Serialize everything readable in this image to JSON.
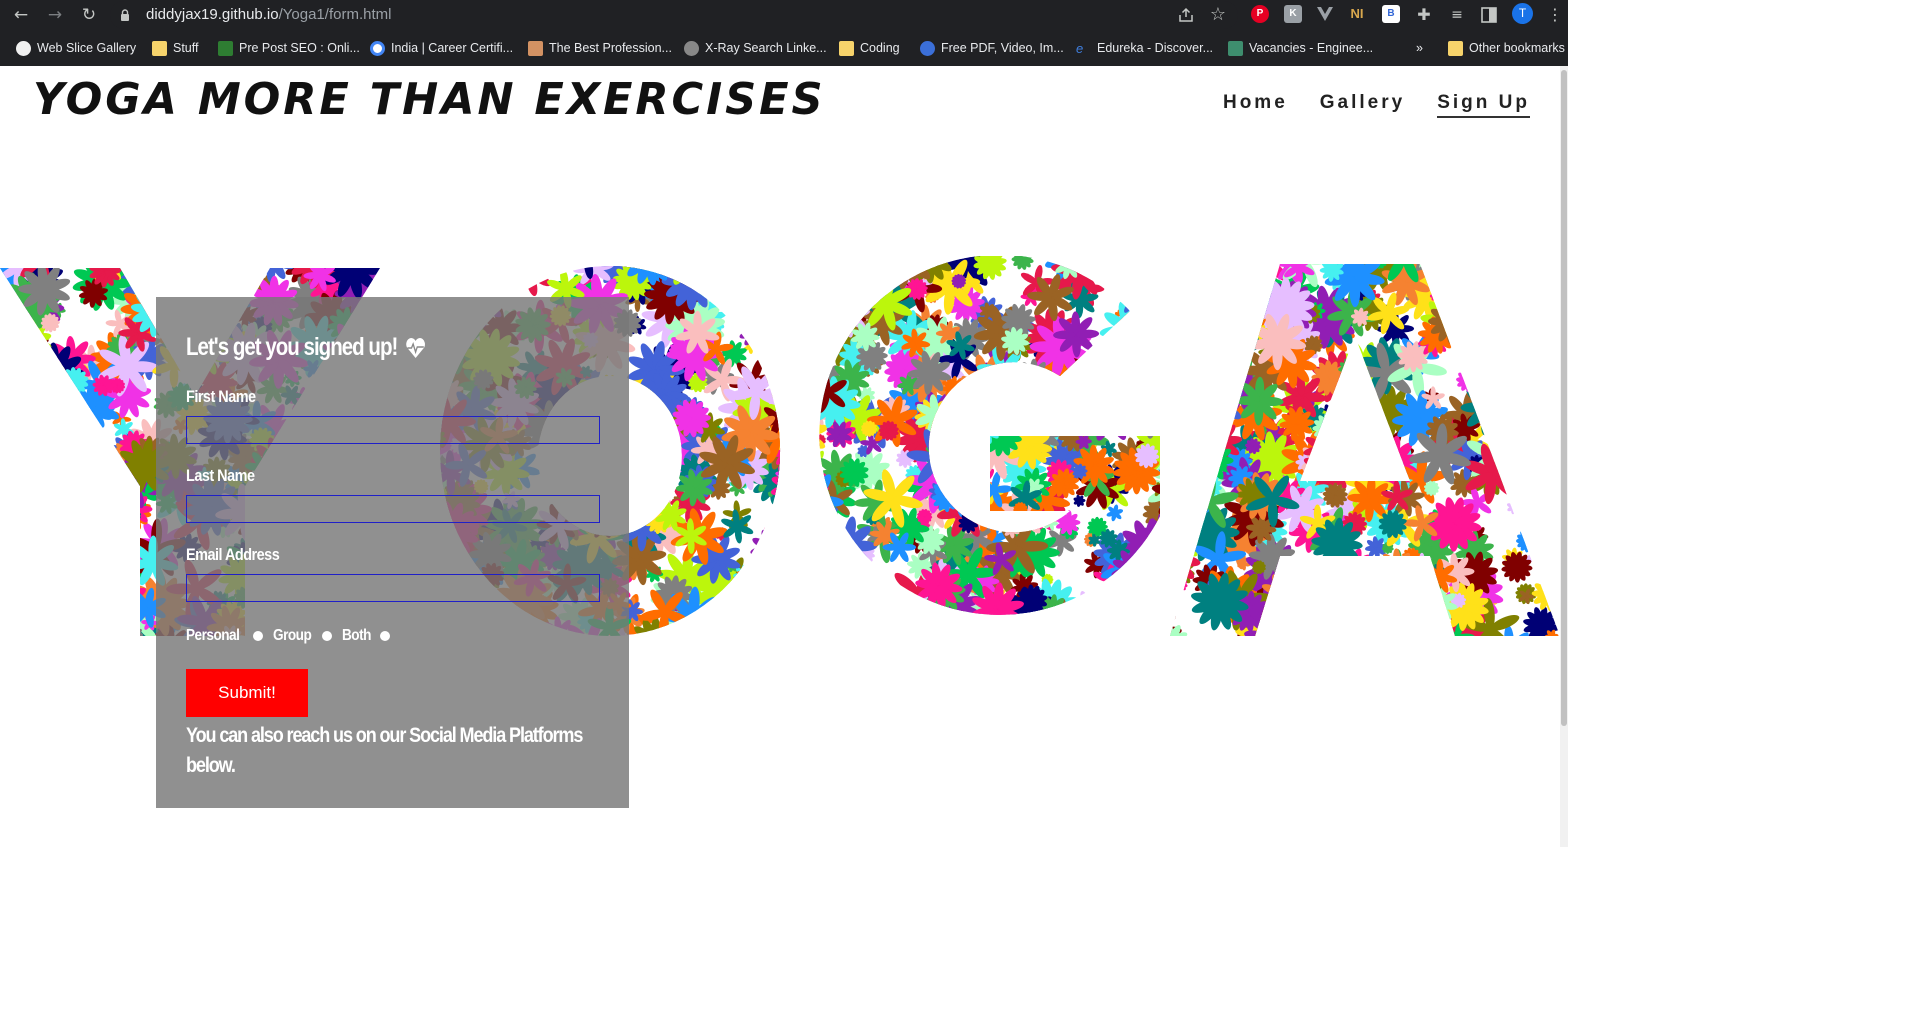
{
  "browser": {
    "url_domain": "diddyjax19.github.io",
    "url_path": "/Yoga1/form.html",
    "profile_initial": "T",
    "bookmarks": [
      {
        "label": "Web Slice Gallery"
      },
      {
        "label": "Stuff"
      },
      {
        "label": "Pre Post SEO : Onli..."
      },
      {
        "label": "India | Career Certifi..."
      },
      {
        "label": "The Best Profession..."
      },
      {
        "label": "X-Ray Search Linke..."
      },
      {
        "label": "Coding"
      },
      {
        "label": "Free PDF, Video, Im..."
      },
      {
        "label": "Edureka - Discover..."
      },
      {
        "label": "Vacancies - Enginee..."
      }
    ],
    "overflow_label": "»",
    "other_bookmarks": "Other bookmarks"
  },
  "site": {
    "title": "YOGA MORE THAN EXERCISES",
    "nav": [
      {
        "label": "Home"
      },
      {
        "label": "Gallery"
      },
      {
        "label": "Sign Up"
      }
    ]
  },
  "form": {
    "heading": "Let's get you signed up!",
    "first_name_label": "First Name",
    "last_name_label": "Last Name",
    "email_label": "Email Address",
    "first_name_value": "",
    "last_name_value": "",
    "email_value": "",
    "options": [
      {
        "label": "Personal"
      },
      {
        "label": "Group"
      },
      {
        "label": "Both"
      }
    ],
    "submit_label": "Submit!",
    "social_note": "You can also reach us on our Social Media Platforms below."
  },
  "colors": {
    "chrome_bg": "#202124",
    "panel_bg": "#787878",
    "submit_bg": "#ff0000",
    "input_border": "#2020c8"
  }
}
